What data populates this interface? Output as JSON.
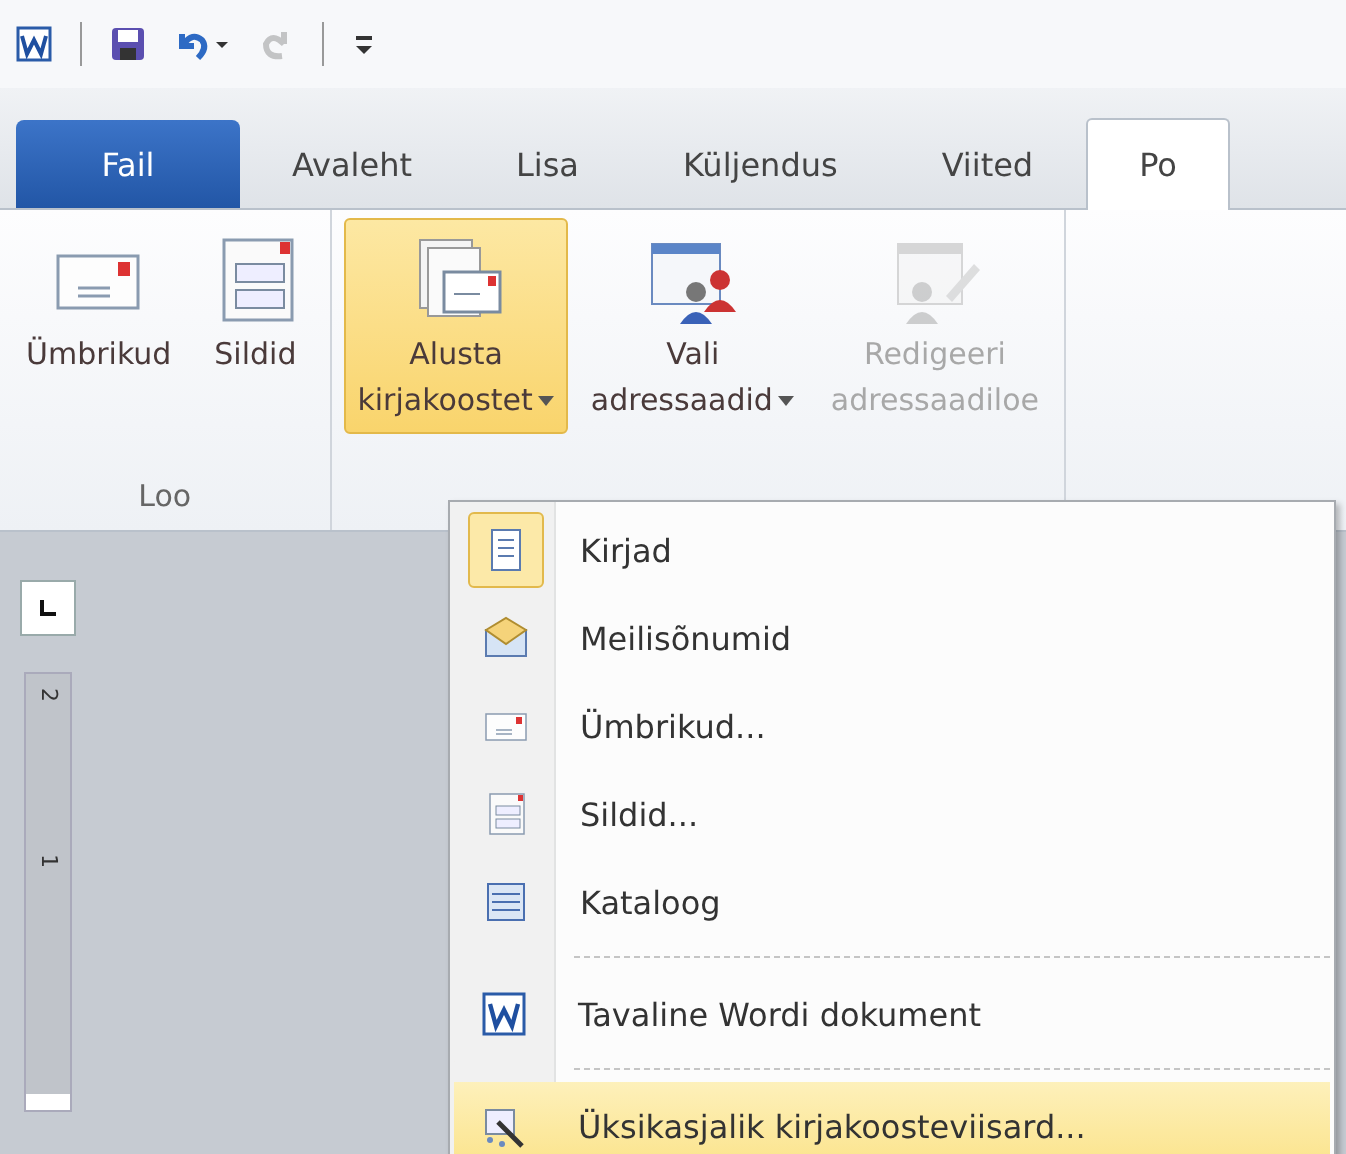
{
  "quick_access": [
    {
      "kind": "app",
      "disabled": false
    },
    {
      "kind": "save",
      "disabled": false
    },
    {
      "kind": "undo",
      "disabled": false
    },
    {
      "kind": "redo",
      "disabled": true
    },
    {
      "kind": "customize",
      "disabled": false
    }
  ],
  "tabs": [
    {
      "label": "Fail",
      "kind": "file",
      "selected": false
    },
    {
      "label": "Avaleht",
      "kind": "tab",
      "selected": false
    },
    {
      "label": "Lisa",
      "kind": "tab",
      "selected": false
    },
    {
      "label": "Küljendus",
      "kind": "tab",
      "selected": false
    },
    {
      "label": "Viited",
      "kind": "tab",
      "selected": false
    },
    {
      "label": "Po",
      "kind": "tab",
      "selected": true
    }
  ],
  "ribbon_groups": [
    {
      "label": "Loo",
      "buttons": [
        {
          "lines": [
            "Ümbrikud"
          ],
          "kind": "envelope",
          "dropdown": false,
          "pressed": false,
          "disabled": false
        },
        {
          "lines": [
            "Sildid"
          ],
          "kind": "labels",
          "dropdown": false,
          "pressed": false,
          "disabled": false
        }
      ]
    },
    {
      "buttons": [
        {
          "lines": [
            "Alusta",
            "kirjakoostet"
          ],
          "kind": "documents",
          "dropdown": true,
          "pressed": true,
          "disabled": false
        },
        {
          "lines": [
            "Vali",
            "adressaadid"
          ],
          "kind": "recipients",
          "dropdown": true,
          "pressed": false,
          "disabled": false
        },
        {
          "lines": [
            "Redigeeri",
            "adressaadiloe"
          ],
          "kind": "edit-list",
          "dropdown": false,
          "pressed": false,
          "disabled": true
        }
      ]
    }
  ],
  "ruler": {
    "labels": [
      "2",
      "1"
    ]
  },
  "menu": {
    "items": [
      {
        "label": "Kirjad",
        "kind": "letter",
        "separator_before": false,
        "checked": true,
        "selected": false
      },
      {
        "label": "Meilisõnumid",
        "kind": "email",
        "separator_before": false,
        "checked": false,
        "selected": false
      },
      {
        "label": "Ümbrikud...",
        "kind": "envelope",
        "separator_before": false,
        "checked": false,
        "selected": false
      },
      {
        "label": "Sildid...",
        "kind": "labels",
        "separator_before": false,
        "checked": false,
        "selected": false
      },
      {
        "label": "Kataloog",
        "kind": "list",
        "separator_before": false,
        "checked": false,
        "selected": false
      },
      {
        "label": "Tavaline Wordi dokument",
        "kind": "word",
        "separator_before": true,
        "checked": false,
        "selected": false
      },
      {
        "label": "Üksikasjalik kirjakoosteviisard...",
        "kind": "wizard",
        "separator_before": true,
        "checked": false,
        "selected": true
      }
    ]
  }
}
